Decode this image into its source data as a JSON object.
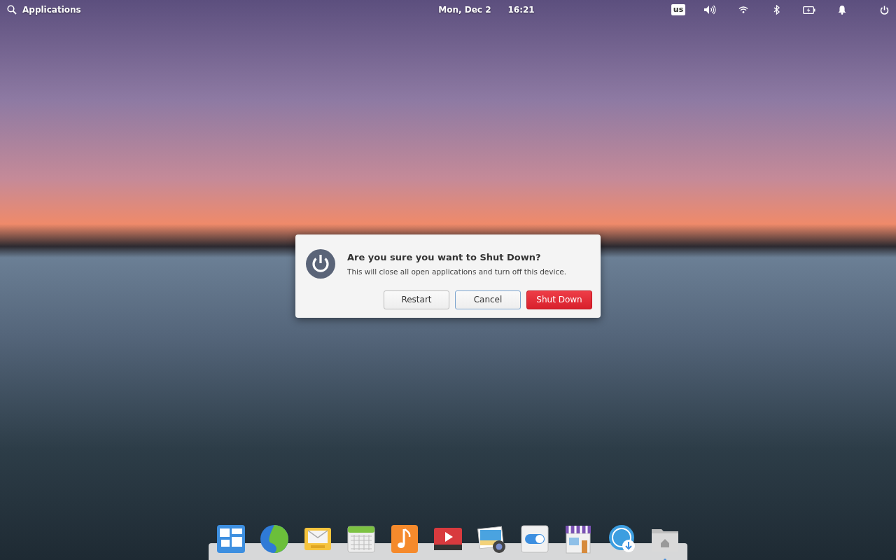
{
  "top_bar": {
    "applications_label": "Applications",
    "date": "Mon, Dec 2",
    "time": "16:21",
    "keyboard_layout": "us"
  },
  "dialog": {
    "title": "Are you sure you want to Shut Down?",
    "message": "This will close all open applications and turn off this device.",
    "buttons": [
      {
        "label": "Restart",
        "kind": "default",
        "focused": false
      },
      {
        "label": "Cancel",
        "kind": "default",
        "focused": true
      },
      {
        "label": "Shut Down",
        "kind": "destructive",
        "focused": false
      }
    ]
  },
  "dock": [
    {
      "kind": "multitasking",
      "running": false
    },
    {
      "kind": "browser",
      "running": false
    },
    {
      "kind": "mail",
      "running": false
    },
    {
      "kind": "calendar",
      "running": false
    },
    {
      "kind": "music",
      "running": false
    },
    {
      "kind": "videos",
      "running": false
    },
    {
      "kind": "photos",
      "running": false
    },
    {
      "kind": "settings",
      "running": false
    },
    {
      "kind": "store",
      "running": false
    },
    {
      "kind": "installer",
      "running": false
    },
    {
      "kind": "files",
      "running": true
    }
  ]
}
